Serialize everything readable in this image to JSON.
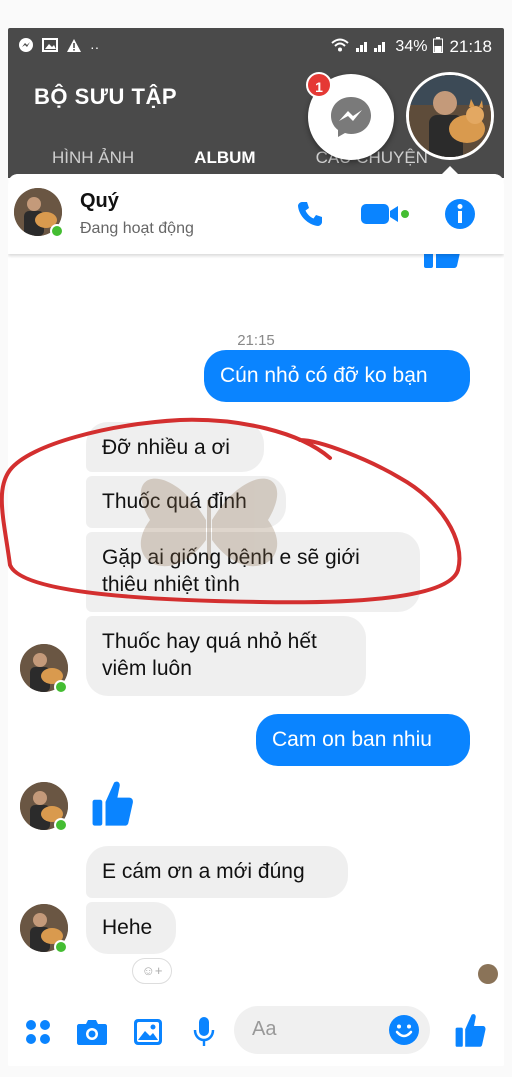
{
  "status_bar": {
    "left_icons": [
      "messenger-icon",
      "image-icon",
      "warning-icon",
      "more-dots-icon"
    ],
    "battery": "34%",
    "time": "21:18"
  },
  "background_app": {
    "title": "BỘ SƯU TẬP",
    "tabs": [
      "HÌNH ẢNH",
      "ALBUM",
      "CÂU CHUYỆN"
    ],
    "active_tab": "ALBUM"
  },
  "chat_heads": {
    "messenger_badge": "1"
  },
  "chat_header": {
    "name": "Quý",
    "status": "Đang hoạt động",
    "actions": [
      "phone-icon",
      "video-icon",
      "info-icon"
    ],
    "accent_color": "#0a84ff"
  },
  "conversation": {
    "time_label": "21:15",
    "messages": [
      {
        "side": "out",
        "text": "Cún nhỏ có đỡ ko bạn"
      },
      {
        "side": "in",
        "text": "Đỡ nhiều a ơi"
      },
      {
        "side": "in",
        "text": "Thuốc quá đỉnh"
      },
      {
        "side": "in",
        "text": "Gặp ai giống bệnh e sẽ giới thiêu nhiệt tình"
      },
      {
        "side": "in",
        "text": "Thuốc hay quá nhỏ hết viêm luôn"
      },
      {
        "side": "out",
        "text": "Cam on ban nhiu"
      },
      {
        "side": "in",
        "text": "like"
      },
      {
        "side": "in",
        "text": "E cám ơn a mới đúng"
      },
      {
        "side": "in",
        "text": "Hehe"
      }
    ]
  },
  "composer": {
    "placeholder": "Aa",
    "icons": [
      "apps-icon",
      "camera-icon",
      "gallery-icon",
      "mic-icon",
      "emoji-icon",
      "like-icon"
    ]
  },
  "colors": {
    "bubble_out": "#0a84ff",
    "bubble_in": "#efefef",
    "annotation_circle": "#d32f2f",
    "online": "#44bd32"
  }
}
